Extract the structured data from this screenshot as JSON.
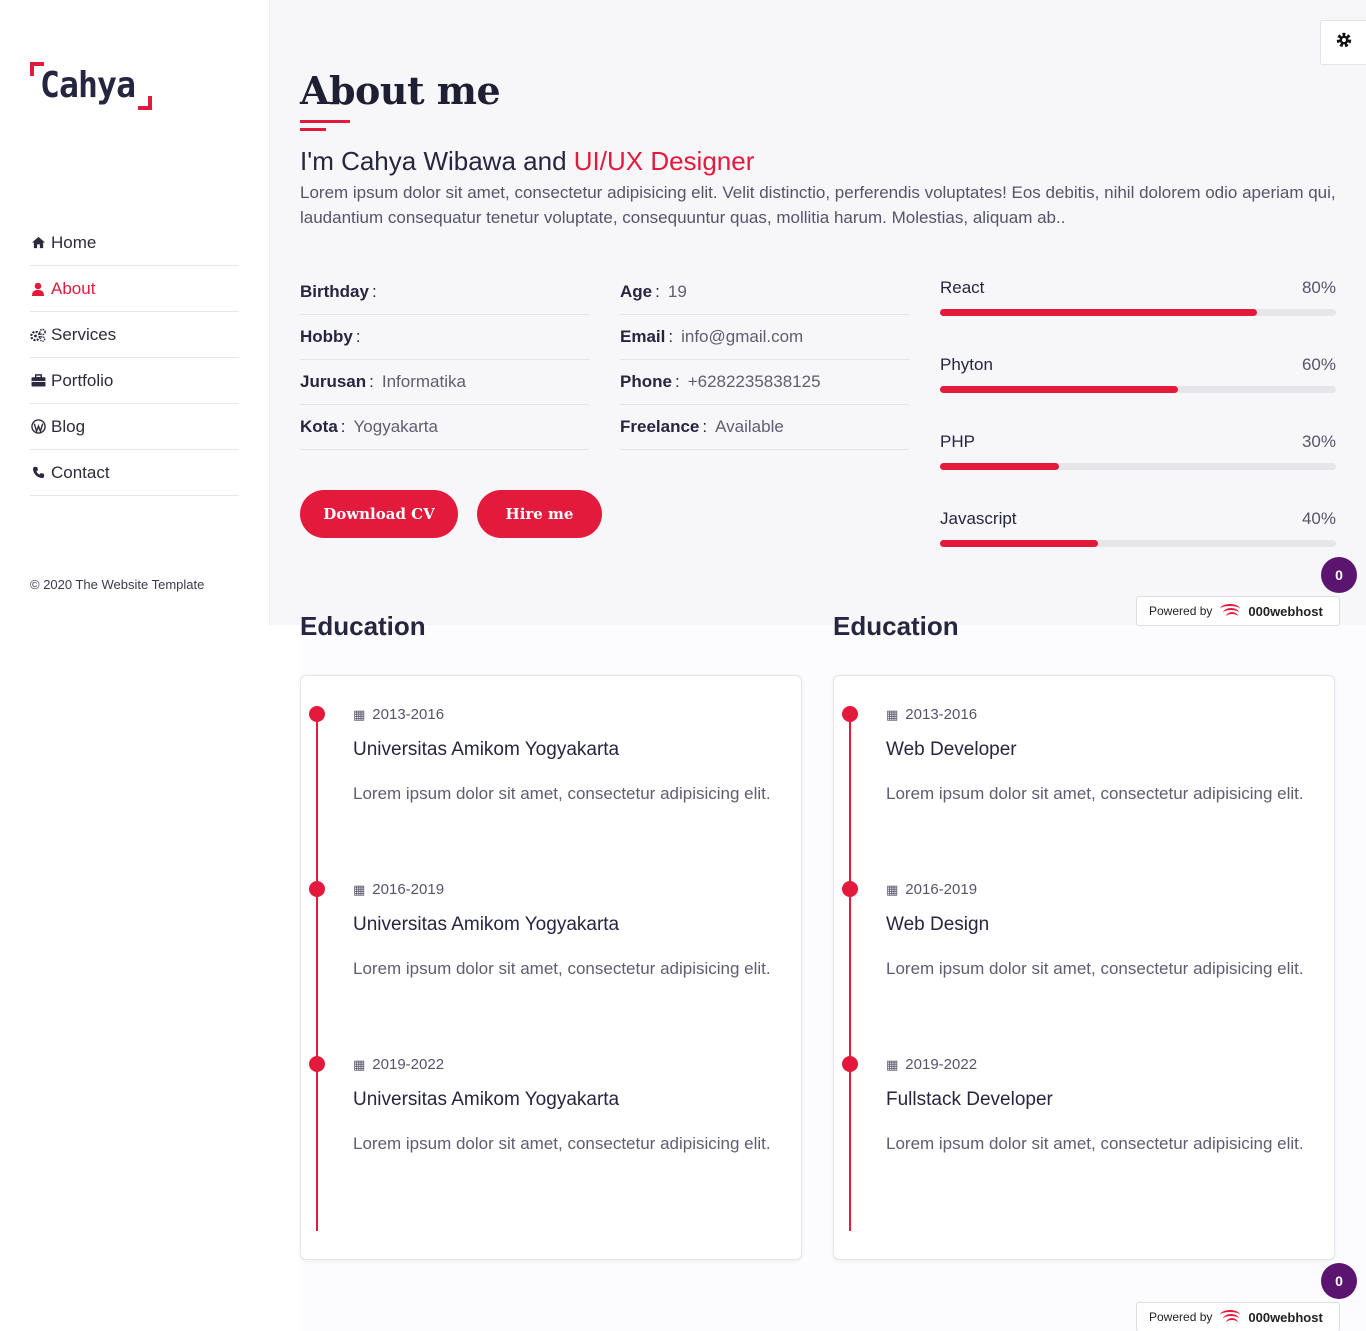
{
  "logo": {
    "text": "Cahya"
  },
  "nav": {
    "items": [
      {
        "label": "Home",
        "icon": "home-icon"
      },
      {
        "label": "About",
        "icon": "user-icon",
        "active": true
      },
      {
        "label": "Services",
        "icon": "cogs-icon"
      },
      {
        "label": "Portfolio",
        "icon": "briefcase-icon"
      },
      {
        "label": "Blog",
        "icon": "wordpress-icon"
      },
      {
        "label": "Contact",
        "icon": "phone-icon"
      }
    ]
  },
  "footer": {
    "copyright": "© 2020 The Website Template"
  },
  "about": {
    "title": "About me",
    "intro_name": "I'm Cahya Wibawa and ",
    "intro_role": "UI/UX Designer",
    "intro_text": "Lorem ipsum dolor sit amet, consectetur adipisicing elit. Velit distinctio, perferendis voluptates! Eos debitis, nihil dolorem odio aperiam qui, laudantium consequatur tenetur voluptate, consequuntur quas, mollitia harum. Molestias, aliquam ab.."
  },
  "info": {
    "left": [
      {
        "key": "Birthday",
        "value": ""
      },
      {
        "key": "Hobby",
        "value": ""
      },
      {
        "key": "Jurusan",
        "value": "Informatika"
      },
      {
        "key": "Kota",
        "value": "Yogyakarta"
      }
    ],
    "right": [
      {
        "key": "Age",
        "value": "19"
      },
      {
        "key": "Email",
        "value": "info@gmail.com"
      },
      {
        "key": "Phone",
        "value": "+6282235838125"
      },
      {
        "key": "Freelance",
        "value": "Available"
      }
    ]
  },
  "buttons": {
    "download": "Download CV",
    "hire": "Hire me"
  },
  "skills": [
    {
      "name": "React",
      "percent_label": "80%",
      "percent": 80
    },
    {
      "name": "Phyton",
      "percent_label": "60%",
      "percent": 60
    },
    {
      "name": "PHP",
      "percent_label": "30%",
      "percent": 30
    },
    {
      "name": "Javascript",
      "percent_label": "40%",
      "percent": 40
    }
  ],
  "badge": {
    "count": "0"
  },
  "powered": {
    "prefix": "Powered by",
    "brand": "000webhost"
  },
  "education_left": {
    "title": "Education",
    "items": [
      {
        "date": "2013-2016",
        "name": "Universitas Amikom Yogyakarta",
        "desc": "Lorem ipsum dolor sit amet, consectetur adipisicing elit."
      },
      {
        "date": "2016-2019",
        "name": "Universitas Amikom Yogyakarta",
        "desc": "Lorem ipsum dolor sit amet, consectetur adipisicing elit."
      },
      {
        "date": "2019-2022",
        "name": "Universitas Amikom Yogyakarta",
        "desc": "Lorem ipsum dolor sit amet, consectetur adipisicing elit."
      }
    ]
  },
  "education_right": {
    "title": "Education",
    "items": [
      {
        "date": "2013-2016",
        "name": "Web Developer",
        "desc": "Lorem ipsum dolor sit amet, consectetur adipisicing elit."
      },
      {
        "date": "2016-2019",
        "name": "Web Design",
        "desc": "Lorem ipsum dolor sit amet, consectetur adipisicing elit."
      },
      {
        "date": "2019-2022",
        "name": "Fullstack Developer",
        "desc": "Lorem ipsum dolor sit amet, consectetur adipisicing elit."
      }
    ]
  },
  "colors": {
    "accent": "#e31a3c",
    "dark": "#262640",
    "badge": "#5b1570"
  }
}
